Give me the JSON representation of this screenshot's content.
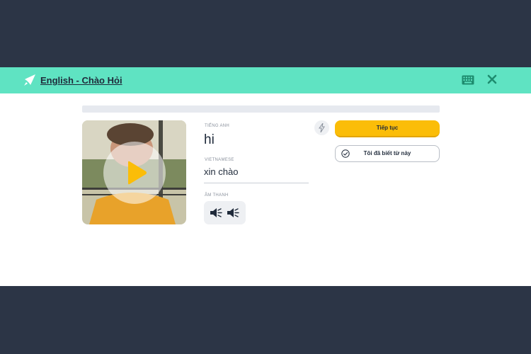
{
  "header": {
    "course_title": "English - Chào Hỏi",
    "logo_icon": "rocket-logo-icon",
    "keyboard_icon": "keyboard-icon",
    "close_icon": "close-icon"
  },
  "progress": {
    "fraction": 0.0
  },
  "video": {
    "play_icon": "play-icon"
  },
  "word": {
    "source_label": "TIẾNG ANH",
    "source_text": "hi",
    "target_label": "VIETNAMESE",
    "target_text": "xin chào",
    "audio_label": "ÂM THANH"
  },
  "actions": {
    "continue_label": "Tiếp tục",
    "known_label": "Tôi đã biết từ này"
  },
  "colors": {
    "header_bg": "#5fe3c2",
    "page_bg": "#2c3546",
    "accent_yellow": "#fbbd08",
    "text_dark": "#1f2a3a"
  }
}
